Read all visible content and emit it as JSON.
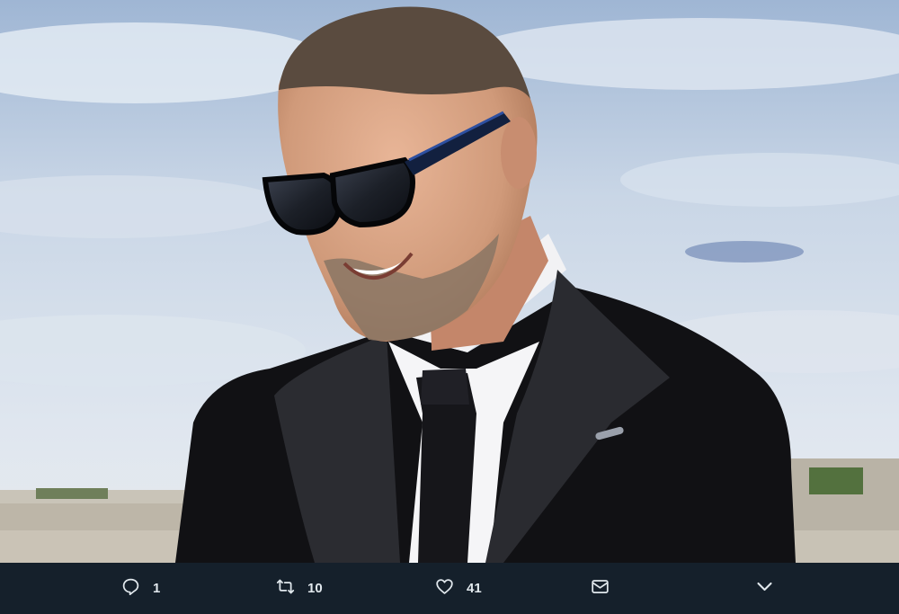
{
  "tweet": {
    "media": {
      "photo_subject": "man-in-sunglasses-and-tuxedo"
    },
    "actions": {
      "reply_count": "1",
      "retweet_count": "10",
      "like_count": "41"
    },
    "icons": {
      "reply": "reply-icon",
      "retweet": "retweet-icon",
      "like": "heart-icon",
      "dm": "envelope-icon",
      "more": "chevron-down-icon"
    },
    "colors": {
      "bar_background": "#15202b",
      "icon": "#e1e8ed"
    }
  }
}
